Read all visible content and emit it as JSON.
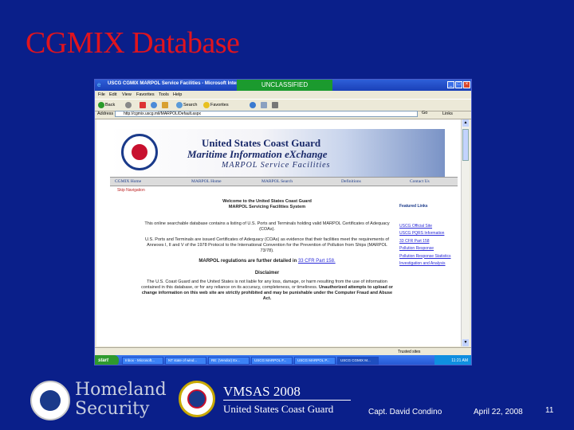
{
  "slide": {
    "title": "CGMIX Database",
    "footer": {
      "homeland_line1": "Homeland",
      "homeland_line2": "Security",
      "conference": "VMSAS 2008",
      "org": "United States Coast Guard",
      "presenter": "Capt. David Condino",
      "date": "April 22, 2008",
      "slide_number": "11"
    }
  },
  "browser": {
    "window_title": "USCG CGMIX MARPOL Service Facilities - Microsoft Internet Explorer",
    "classification": "UNCLASSIFIED",
    "menu": [
      "File",
      "Edit",
      "View",
      "Favorites",
      "Tools",
      "Help"
    ],
    "toolbar": {
      "back": "Back",
      "search": "Search",
      "favorites": "Favorites"
    },
    "address_label": "Address",
    "address": "http://cgmix.uscg.mil/MARPOL/Default.aspx",
    "go_label": "Go",
    "links_label": "Links",
    "status_zone": "Trusted sites"
  },
  "page": {
    "banner": {
      "line1": "United States Coast Guard",
      "line2": "Maritime Information eXchange",
      "line3": "MARPOL Service Facilities"
    },
    "nav": [
      "CGMIX Home",
      "MARPOL Home",
      "MARPOL Search",
      "Definitions",
      "Contact Us"
    ],
    "skip_nav": "Skip Navigation",
    "welcome_1": "Welcome to the United States Coast Guard",
    "welcome_2": "MARPOL Servicing Facilities System",
    "intro": "This online searchable database contains a listing of U.S. Ports and Terminals holding valid MARPOL Certificates of Adequacy (COAs).",
    "coa_text": "U.S. Ports and Terminals are issued Certificates of Adequacy (COAs) as evidence that their facilities meet the requirements of Annexes I, II and V of the 1978 Protocol to the International Convention for the Prevention of Pollution from Ships (MARPOL 73/78).",
    "regs_text": "MARPOL regulations are further detailed in",
    "regs_link": "33 CFR Part 158.",
    "disclaimer_title": "Disclaimer",
    "disclaimer_text": "The U.S. Coast Guard and the United States is not liable for any loss, damage, or harm resulting from the use of information contained in this database, or for any reliance on its accuracy, completeness, or timeliness.",
    "disclaimer_warn": "Unauthorized attempts to upload or change information on this web site are strictly prohibited and may be punishable under the Computer Fraud and Abuse Act.",
    "featured": {
      "heading": "Featured Links",
      "items": [
        "USCG Official Site",
        "USCG PQRS Information",
        "33 CFR Part 158",
        "Pollution Response",
        "Pollution Response Statistics",
        "Investigation and Analysis"
      ]
    }
  },
  "taskbar": {
    "start": "start",
    "tasks": [
      "Inbox - Microsoft...",
      "NT state of wind...",
      "RE: (Vendor) Ex...",
      "USCG MARPOL F...",
      "USCG MARPOL P...",
      "USCG CGMIX M..."
    ],
    "clock": "11:21 AM"
  },
  "colors": {
    "slide_bg": "#0a1f8a",
    "title_red": "#e0141e",
    "classification_green": "#1b9a2e"
  }
}
